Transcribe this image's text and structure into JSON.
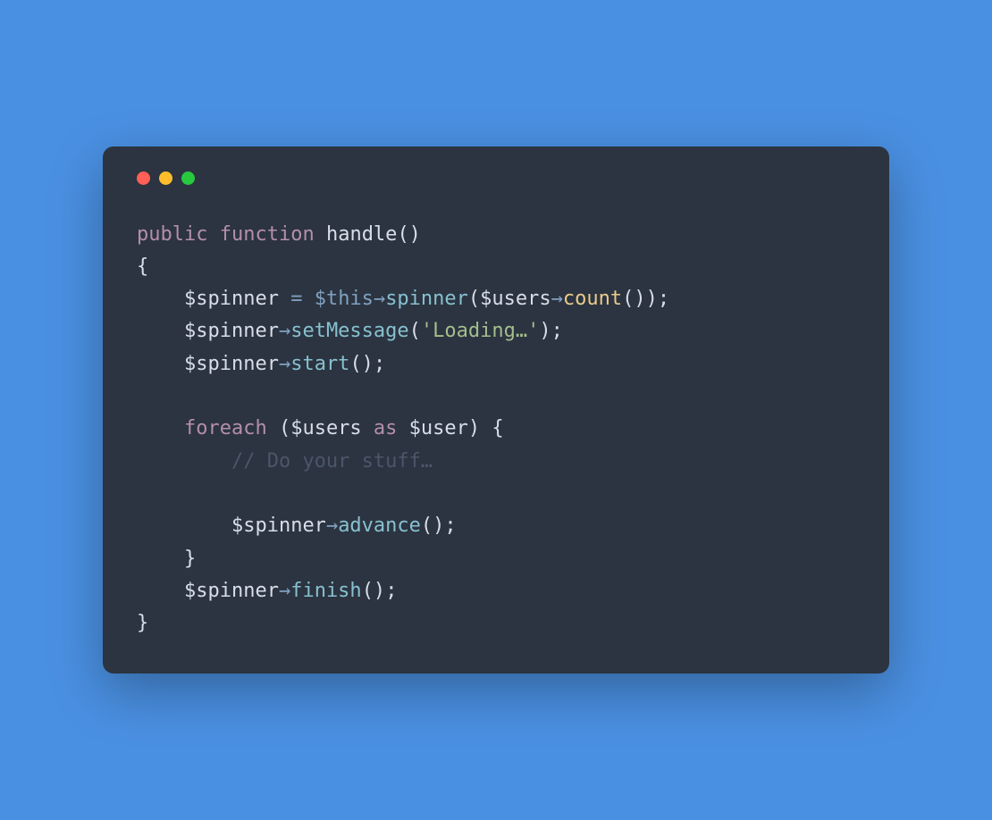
{
  "code": {
    "line1": {
      "keyword1": "public",
      "keyword2": "function",
      "name": "handle",
      "parens": "()"
    },
    "line2": {
      "brace": "{"
    },
    "line3": {
      "indent": "    ",
      "var1": "$spinner",
      "op": " = ",
      "this": "$this",
      "arrow": "→",
      "method": "spinner",
      "paren1": "(",
      "var2": "$users",
      "arrow2": "→",
      "method2": "count",
      "parens2": "()",
      "paren2": ")",
      "semi": ";"
    },
    "line4": {
      "indent": "    ",
      "var1": "$spinner",
      "arrow": "→",
      "method": "setMessage",
      "paren1": "(",
      "string": "'Loading…'",
      "paren2": ")",
      "semi": ";"
    },
    "line5": {
      "indent": "    ",
      "var1": "$spinner",
      "arrow": "→",
      "method": "start",
      "parens": "()",
      "semi": ";"
    },
    "line6": {
      "blank": ""
    },
    "line7": {
      "indent": "    ",
      "keyword": "foreach",
      "paren1": " (",
      "var1": "$users",
      "keyword2": " as ",
      "var2": "$user",
      "paren2": ") ",
      "brace": "{"
    },
    "line8": {
      "indent": "        ",
      "comment": "// Do your stuff…"
    },
    "line9": {
      "blank": ""
    },
    "line10": {
      "indent": "        ",
      "var1": "$spinner",
      "arrow": "→",
      "method": "advance",
      "parens": "()",
      "semi": ";"
    },
    "line11": {
      "indent": "    ",
      "brace": "}"
    },
    "line12": {
      "indent": "    ",
      "var1": "$spinner",
      "arrow": "→",
      "method": "finish",
      "parens": "()",
      "semi": ";"
    },
    "line13": {
      "brace": "}"
    }
  }
}
